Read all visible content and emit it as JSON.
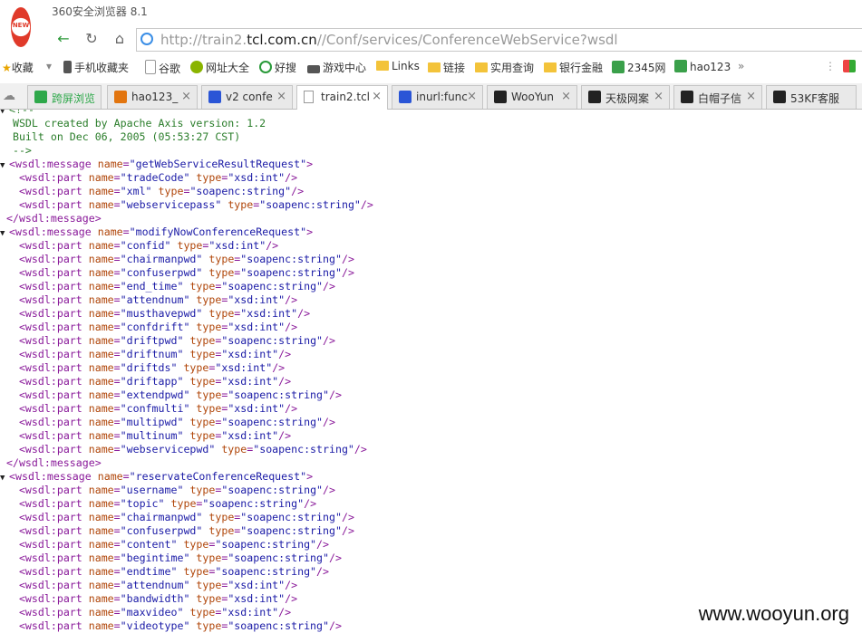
{
  "app": {
    "title": "360安全浏览器 8.1",
    "logo_text": "NEW"
  },
  "address": {
    "prefix": "http://train2.",
    "domain": "tcl.com.cn",
    "path": "//Conf/services/ConferenceWebService?wsdl"
  },
  "favorites": [
    {
      "label": "收藏",
      "icon": "star-icon"
    },
    {
      "label": "手机收藏夹",
      "icon": "folder-icon"
    },
    {
      "label": "谷歌",
      "icon": "page-icon"
    },
    {
      "label": "网址大全",
      "icon": "globe-icon"
    },
    {
      "label": "好搜",
      "icon": "search-icon"
    },
    {
      "label": "游戏中心",
      "icon": "gamepad-icon"
    },
    {
      "label": "Links",
      "icon": "folder-icon"
    },
    {
      "label": "链接",
      "icon": "folder-icon"
    },
    {
      "label": "实用查询",
      "icon": "folder-icon"
    },
    {
      "label": "银行金融",
      "icon": "folder-icon"
    },
    {
      "label": "2345网",
      "icon": "2345-icon"
    },
    {
      "label": "hao123",
      "icon": "2345-icon"
    }
  ],
  "tabs": [
    {
      "label": "跨屏浏览"
    },
    {
      "label": "hao123_"
    },
    {
      "label": "v2 confe"
    },
    {
      "label": "train2.tcl"
    },
    {
      "label": "inurl:func"
    },
    {
      "label": "WooYun"
    },
    {
      "label": "天极网案"
    },
    {
      "label": "白帽子信"
    },
    {
      "label": "53KF客服"
    }
  ],
  "xml": {
    "comment_open": "<!--",
    "comment_1": "WSDL created by Apache Axis version: 1.2",
    "comment_2": "Built on Dec 06, 2005 (05:53:27 CST)",
    "comment_close": "-->",
    "messages": [
      {
        "name": "getWebServiceResultRequest",
        "parts": [
          {
            "name": "tradeCode",
            "type": "xsd:int"
          },
          {
            "name": "xml",
            "type": "soapenc:string"
          },
          {
            "name": "webservicepass",
            "type": "soapenc:string"
          }
        ]
      },
      {
        "name": "modifyNowConferenceRequest",
        "parts": [
          {
            "name": "confid",
            "type": "xsd:int"
          },
          {
            "name": "chairmanpwd",
            "type": "soapenc:string"
          },
          {
            "name": "confuserpwd",
            "type": "soapenc:string"
          },
          {
            "name": "end_time",
            "type": "soapenc:string"
          },
          {
            "name": "attendnum",
            "type": "xsd:int"
          },
          {
            "name": "musthavepwd",
            "type": "xsd:int"
          },
          {
            "name": "confdrift",
            "type": "xsd:int"
          },
          {
            "name": "driftpwd",
            "type": "soapenc:string"
          },
          {
            "name": "driftnum",
            "type": "xsd:int"
          },
          {
            "name": "driftds",
            "type": "xsd:int"
          },
          {
            "name": "driftapp",
            "type": "xsd:int"
          },
          {
            "name": "extendpwd",
            "type": "soapenc:string"
          },
          {
            "name": "confmulti",
            "type": "xsd:int"
          },
          {
            "name": "multipwd",
            "type": "soapenc:string"
          },
          {
            "name": "multinum",
            "type": "xsd:int"
          },
          {
            "name": "webservicepwd",
            "type": "soapenc:string"
          }
        ]
      },
      {
        "name": "reservateConferenceRequest",
        "parts": [
          {
            "name": "username",
            "type": "soapenc:string"
          },
          {
            "name": "topic",
            "type": "soapenc:string"
          },
          {
            "name": "chairmanpwd",
            "type": "soapenc:string"
          },
          {
            "name": "confuserpwd",
            "type": "soapenc:string"
          },
          {
            "name": "content",
            "type": "soapenc:string"
          },
          {
            "name": "begintime",
            "type": "soapenc:string"
          },
          {
            "name": "endtime",
            "type": "soapenc:string"
          },
          {
            "name": "attendnum",
            "type": "xsd:int"
          },
          {
            "name": "bandwidth",
            "type": "xsd:int"
          },
          {
            "name": "maxvideo",
            "type": "xsd:int"
          },
          {
            "name": "videotype",
            "type": "soapenc:string"
          }
        ]
      }
    ]
  },
  "watermark": "www.wooyun.org"
}
